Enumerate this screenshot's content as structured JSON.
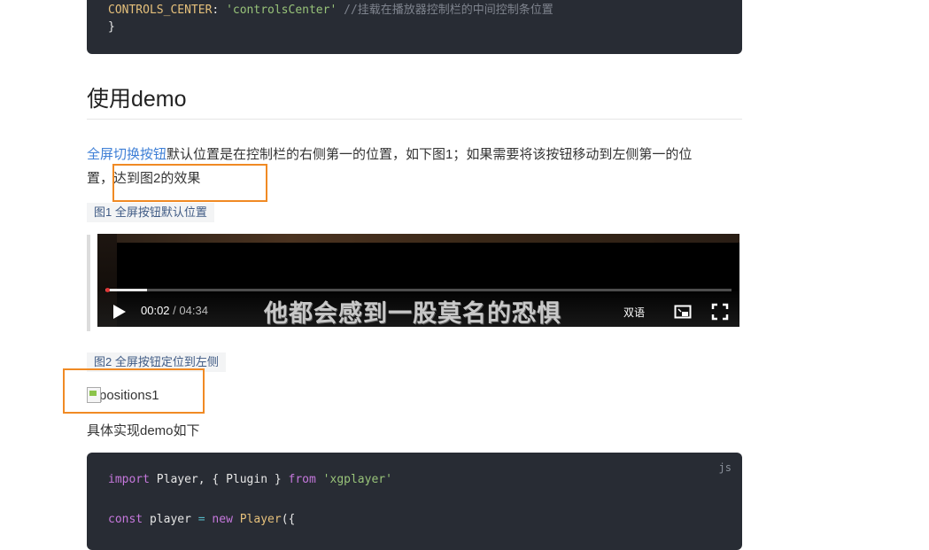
{
  "code_top": {
    "const_name": "CONTROLS_CENTER",
    "colon": ": ",
    "value": "'controlsCenter'",
    "comment": " //挂载在播放器控制栏的中间控制条位置",
    "close_brace": "}"
  },
  "section": {
    "title": "使用demo"
  },
  "intro": {
    "link_text": "全屏切换按钮",
    "text_line1": "默认位置是在控制栏的右侧第一的位置，如下图1；如果需要将该按钮移动到左侧第一的位",
    "text_line2_prefix": "置，",
    "text_line2_rest": "达到图2的效果"
  },
  "figure1": {
    "caption": "图1  全屏按钮默认位置"
  },
  "player": {
    "current_time": "00:02",
    "separator": " / ",
    "duration": "04:34",
    "subtitle": "他都会感到一股莫名的恐惧",
    "language_label": "双语",
    "progress_fraction": 0.066,
    "icons": {
      "play": "play-icon",
      "pip": "pip-icon",
      "fullscreen": "fullscreen-icon"
    }
  },
  "figure2": {
    "caption": "图2  全屏按钮定位到左侧",
    "image_alt": "positions1"
  },
  "demo_intro": "具体实现demo如下",
  "code_demo": {
    "lang": "js",
    "line1": {
      "kw_import": "import",
      "name1": " Player",
      "mid": ", { ",
      "name2": "Plugin",
      "close": " } ",
      "kw_from": "from",
      "module": " 'xgplayer'"
    },
    "line2": {
      "kw_const": "const",
      "var": " player",
      "eq": " = ",
      "kw_new": "new",
      "cls": " Player",
      "open": "({"
    }
  },
  "highlight_color": "#f08a24"
}
